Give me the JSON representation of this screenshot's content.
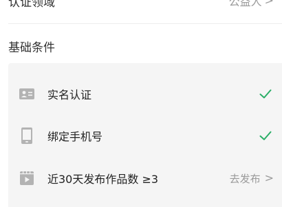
{
  "top_row": {
    "label": "认证领域",
    "value": "公益人",
    "chevron": ">"
  },
  "section": {
    "title": "基础条件"
  },
  "conditions": [
    {
      "icon": "id-card-icon",
      "label": "实名认证",
      "status": "completed"
    },
    {
      "icon": "phone-icon",
      "label": "绑定手机号",
      "status": "completed"
    },
    {
      "icon": "video-icon",
      "label": "近30天发布作品数 ≥3",
      "status": "pending",
      "action_label": "去发布",
      "action_chevron": ">"
    }
  ],
  "colors": {
    "check_green": "#2aae67",
    "muted_text": "#9a9a9a",
    "panel_bg": "#f5f5f5",
    "icon_gray": "#b3b3b3"
  }
}
